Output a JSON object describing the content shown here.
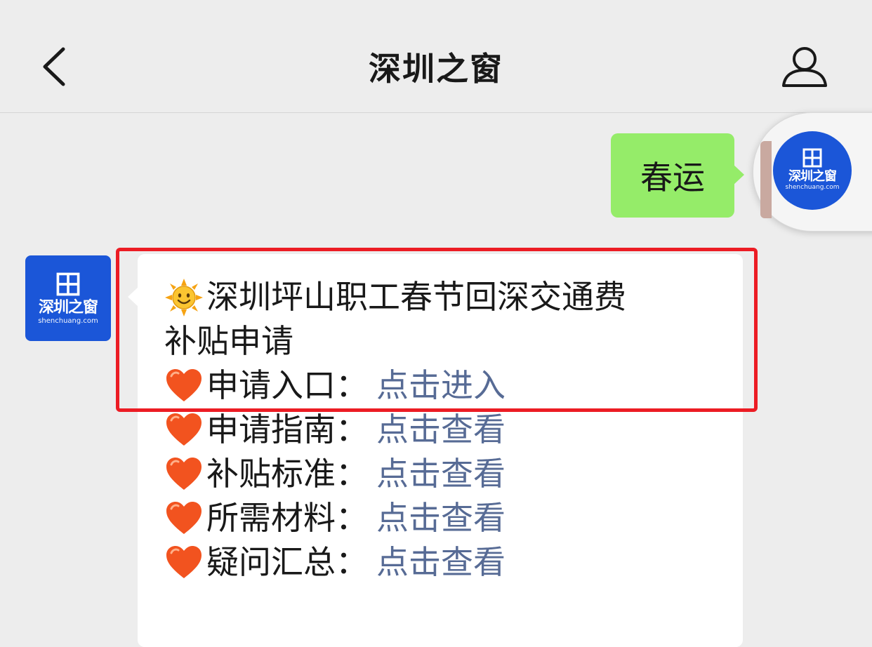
{
  "header": {
    "title": "深圳之窗"
  },
  "outgoing": {
    "text": "春运"
  },
  "brand": {
    "logo_text": "深圳之窗",
    "logo_subtext": "shenchuang.com"
  },
  "incoming": {
    "title_line1": "深圳坪山职工春节回深交通费",
    "title_line2": "补贴申请",
    "items": [
      {
        "label": "申请入口：",
        "link": "点击进入"
      },
      {
        "label": "申请指南：",
        "link": "点击查看"
      },
      {
        "label": "补贴标准：",
        "link": "点击查看"
      },
      {
        "label": "所需材料：",
        "link": "点击查看"
      },
      {
        "label": "疑问汇总：",
        "link": "点击查看"
      }
    ]
  },
  "colors": {
    "outgoing_bubble": "#95ec69",
    "link": "#576b95",
    "highlight": "#ec1c24",
    "brand_blue": "#1b56d8"
  },
  "icons": {
    "title_emoji": "sun-emoji",
    "item_emoji": "orange-heart-emoji"
  }
}
